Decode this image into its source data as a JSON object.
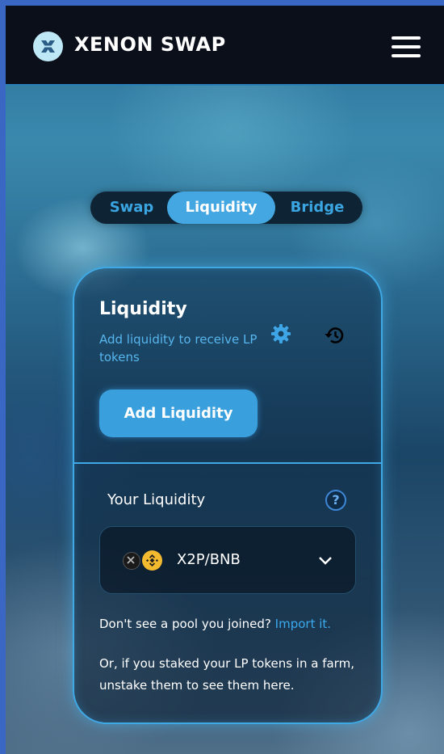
{
  "header": {
    "brand": "XENON SWAP",
    "logo_icon": "xenon-logo-icon",
    "menu_icon": "hamburger-menu-icon"
  },
  "tabs": [
    {
      "label": "Swap",
      "active": false
    },
    {
      "label": "Liquidity",
      "active": true
    },
    {
      "label": "Bridge",
      "active": false
    }
  ],
  "card": {
    "title": "Liquidity",
    "subtitle": "Add liquidity to receive LP tokens",
    "settings_icon": "gear-icon",
    "history_icon": "history-icon",
    "add_button": "Add Liquidity",
    "your_liquidity_label": "Your Liquidity",
    "help_icon": "question-icon",
    "help_glyph": "?",
    "pair": {
      "name": "X2P/BNB",
      "token_icons": [
        "x2p-token-icon",
        "bnb-token-icon"
      ],
      "expand_icon": "chevron-down-icon"
    },
    "import_prompt": "Don't see a pool you joined?",
    "import_link": "Import it.",
    "staked_note": "Or, if you staked your LP tokens in a farm, unstake them to see them here."
  },
  "colors": {
    "accent": "#45a7e2",
    "header_bg": "#0b0f1a",
    "link": "#3aa9ee",
    "bnb": "#f3ba2f"
  }
}
